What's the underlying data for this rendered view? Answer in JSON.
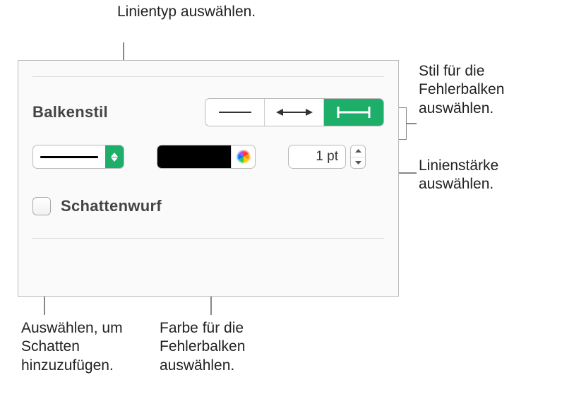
{
  "callouts": {
    "linetype": "Linientyp auswählen.",
    "errorbar_style": "Stil für die Fehlerbalken auswählen.",
    "line_width": "Linienstärke auswählen.",
    "shadow": "Auswählen, um Schatten hinzuzufügen.",
    "color": "Farbe für die Fehlerbalken auswählen."
  },
  "panel": {
    "section_label": "Balkenstil",
    "line_width_value": "1 pt",
    "shadow_label": "Schattenwurf",
    "line_color": "#000000",
    "error_bar_styles": [
      "line",
      "arrow-caps",
      "t-caps"
    ],
    "selected_style_index": 2
  }
}
